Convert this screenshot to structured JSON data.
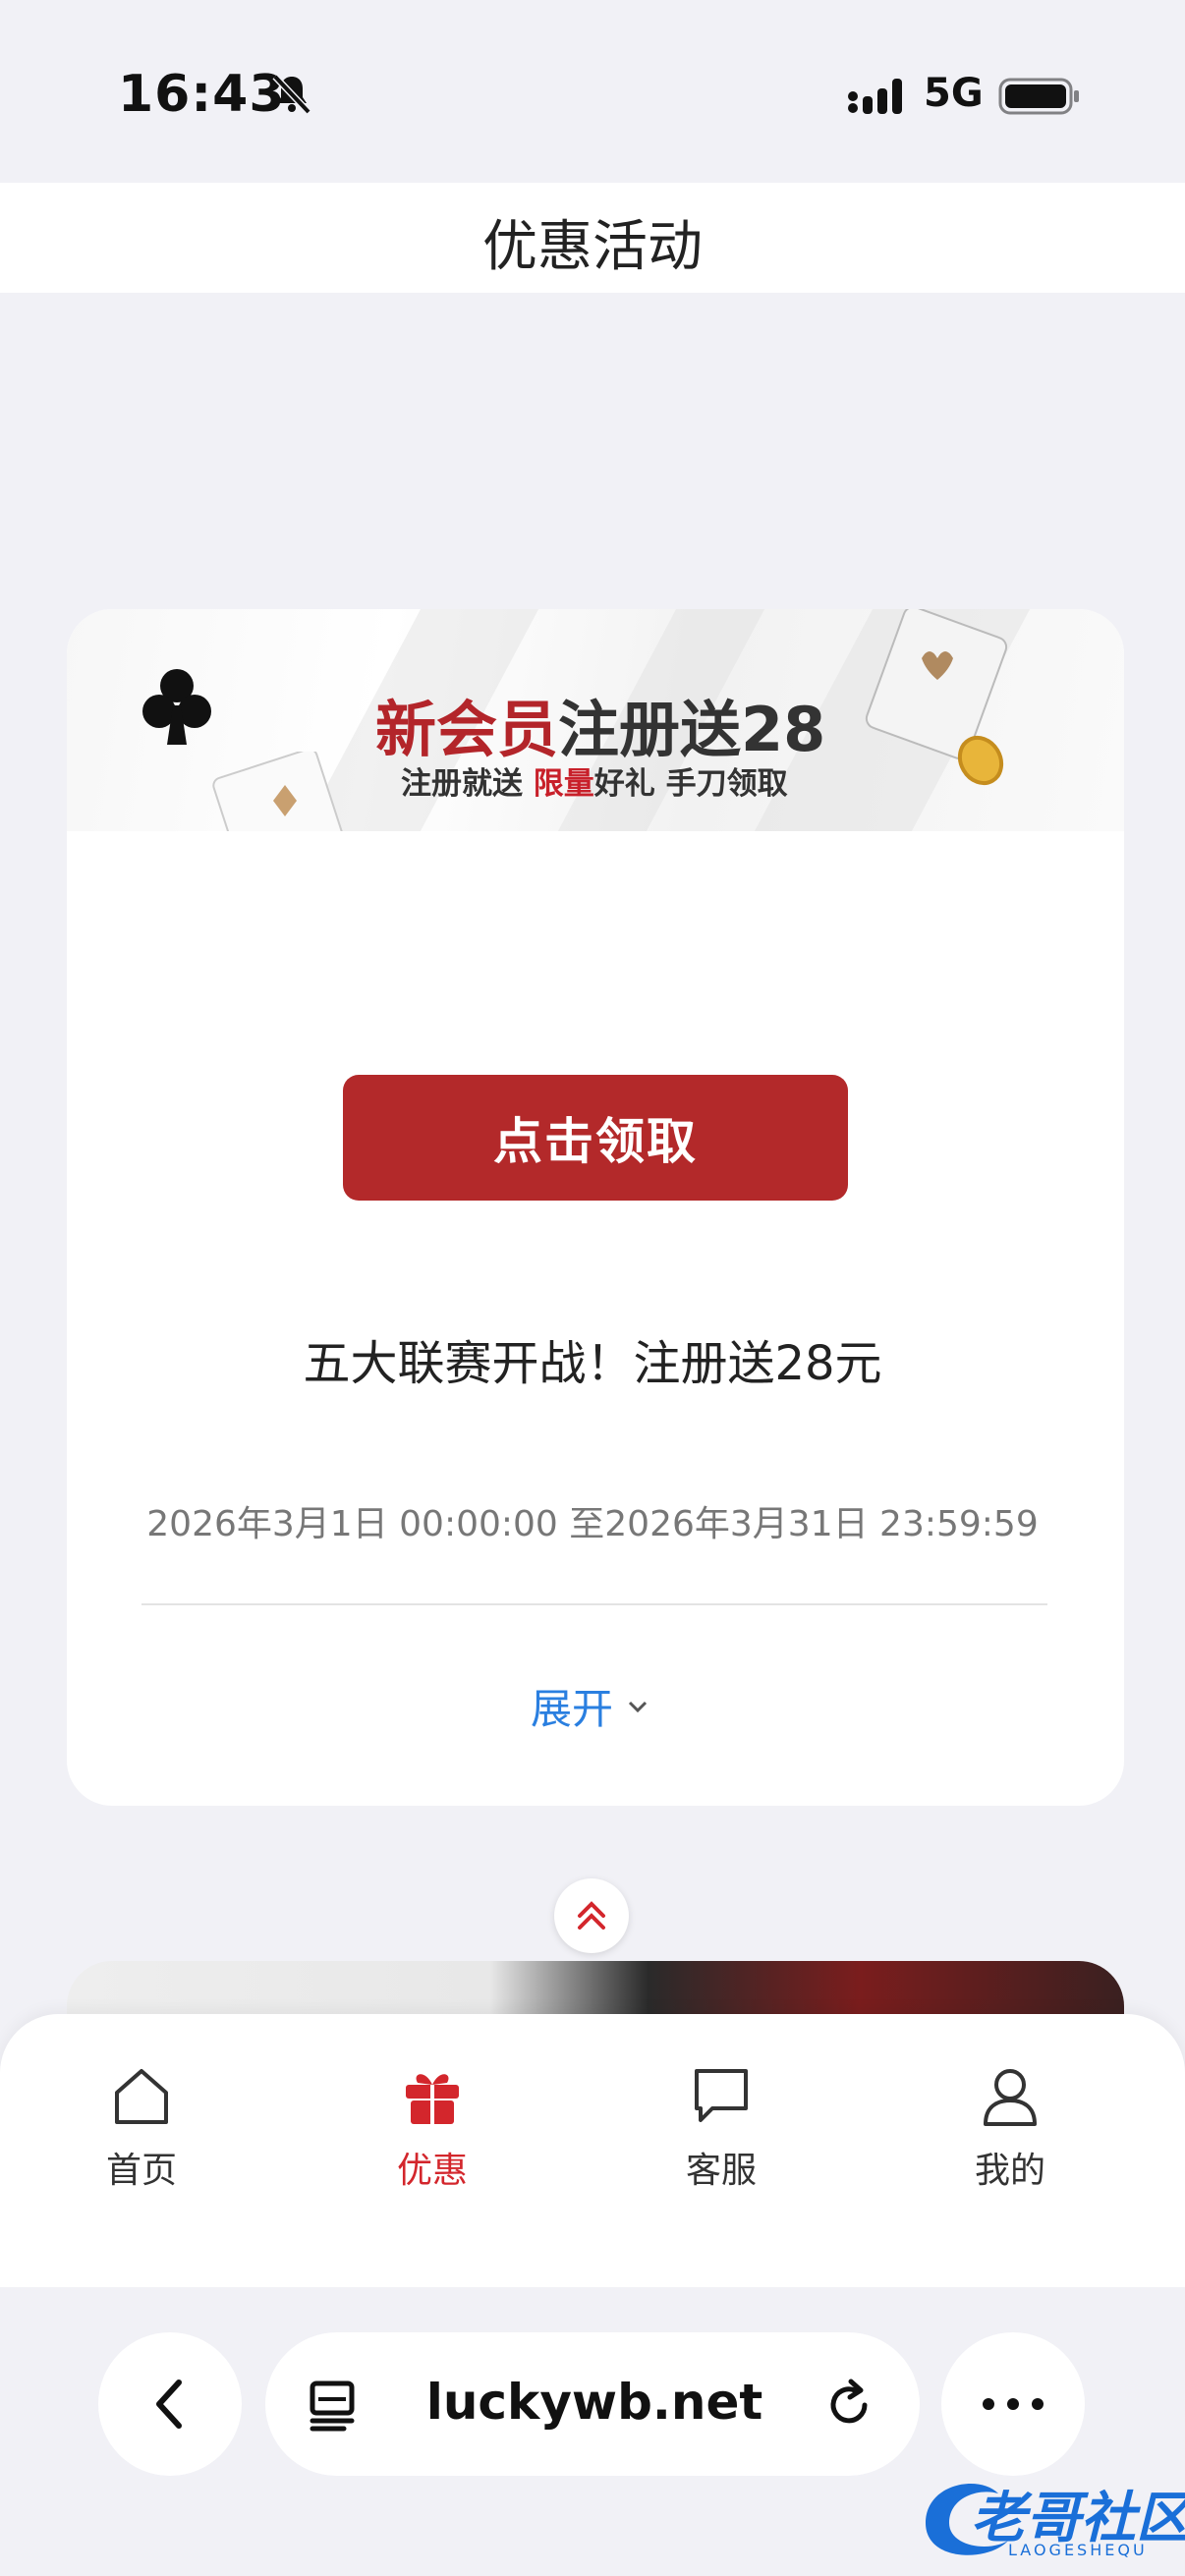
{
  "status_bar": {
    "time": "16:43",
    "network": "5G"
  },
  "header": {
    "title": "优惠活动"
  },
  "promo": {
    "banner_title_red": "新会员",
    "banner_title_dark": "注册送28",
    "banner_sub_prefix": "注册就送",
    "banner_sub_red": "限量",
    "banner_sub_suffix": "好礼 手刀领取",
    "claim_button": "点击领取",
    "title": "五大联赛开战！注册送28元",
    "date_range": "2026年3月1日 00:00:00 至2026年3月31日 23:59:59",
    "expand_label": "展开"
  },
  "tabbar": {
    "items": [
      {
        "label": "首页",
        "icon": "home-icon"
      },
      {
        "label": "优惠",
        "icon": "gift-icon",
        "active": true
      },
      {
        "label": "客服",
        "icon": "chat-icon"
      },
      {
        "label": "我的",
        "icon": "user-icon"
      }
    ]
  },
  "browser": {
    "url": "luckywb.net"
  },
  "watermark": {
    "text": "老哥社区",
    "subtext": "LAOGESHEQU"
  },
  "colors": {
    "accent_red": "#b3292a",
    "tab_active": "#d3262c",
    "link_blue": "#2a7fe0"
  }
}
